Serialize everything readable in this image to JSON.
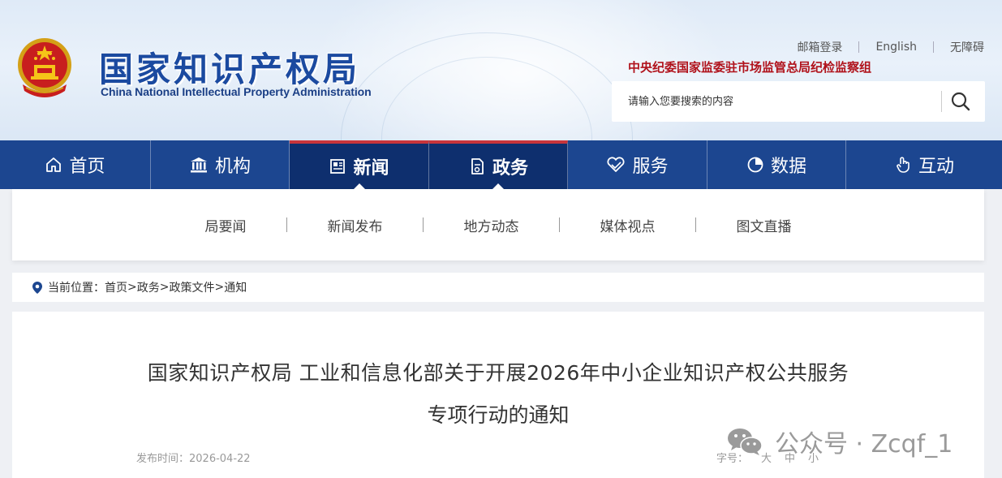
{
  "header": {
    "logo_cn": "国家知识产权局",
    "logo_en": "China National Intellectual Property Administration",
    "top_links": [
      "邮箱登录",
      "English",
      "无障碍"
    ],
    "discipline_text": "中央纪委国家监委驻市场监管总局纪检监察组",
    "search_placeholder": "请输入您要搜索的内容"
  },
  "nav": {
    "items": [
      {
        "label": "首页",
        "icon": "home-icon"
      },
      {
        "label": "机构",
        "icon": "institution-icon"
      },
      {
        "label": "新闻",
        "icon": "news-icon"
      },
      {
        "label": "政务",
        "icon": "gov-affairs-icon"
      },
      {
        "label": "服务",
        "icon": "service-icon"
      },
      {
        "label": "数据",
        "icon": "data-icon"
      },
      {
        "label": "互动",
        "icon": "interaction-icon"
      }
    ],
    "active": [
      "新闻",
      "政务"
    ]
  },
  "subnav": {
    "items": [
      "局要闻",
      "新闻发布",
      "地方动态",
      "媒体视点",
      "图文直播"
    ]
  },
  "breadcrumb": {
    "prefix": "当前位置：",
    "items": [
      "首页",
      "政务",
      "政策文件",
      "通知"
    ],
    "separator": ">"
  },
  "article": {
    "title_line1": "国家知识产权局 工业和信息化部关于开展2026年中小企业知识产权公共服务",
    "title_line2": "专项行动的通知",
    "publish_time_label": "发布时间：",
    "publish_time": "2026-04-22",
    "font_size_label": "字号：",
    "font_size_options": [
      "大",
      "中",
      "小"
    ]
  },
  "watermark": {
    "text": "公众号 · Zcqf_1"
  },
  "colors": {
    "nav_bg": "#1c4690",
    "nav_active_bg": "#0e2f6e",
    "nav_active_top": "#c8353b",
    "logo_blue": "#1b4aa0",
    "discipline_red": "#b0121b"
  }
}
